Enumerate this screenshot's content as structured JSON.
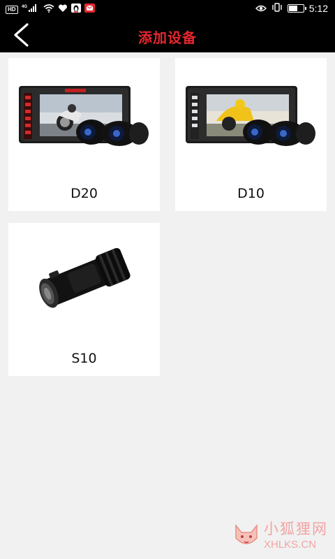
{
  "status_bar": {
    "hd_badge": "HD",
    "network": "4G",
    "time": "5:12",
    "battery_level": 0.65
  },
  "header": {
    "title": "添加设备"
  },
  "devices": [
    {
      "name": "D20"
    },
    {
      "name": "D10"
    },
    {
      "name": "S10"
    }
  ],
  "watermark": {
    "title": "小狐狸网",
    "url": "XHLKS.CN"
  },
  "colors": {
    "title_red": "#e6262e",
    "bar_background": "#000000",
    "page_background": "#f1f1f1"
  }
}
